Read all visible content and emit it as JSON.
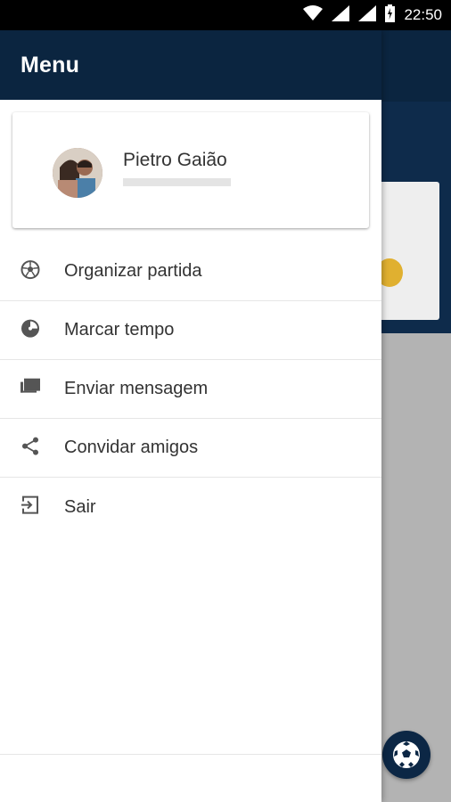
{
  "status_bar": {
    "time": "22:50"
  },
  "drawer": {
    "title": "Menu",
    "profile": {
      "name": "Pietro Gaião"
    },
    "items": [
      {
        "label": "Organizar partida",
        "icon": "soccer-ball-icon"
      },
      {
        "label": "Marcar tempo",
        "icon": "timer-icon"
      },
      {
        "label": "Enviar mensagem",
        "icon": "message-icon"
      },
      {
        "label": "Convidar amigos",
        "icon": "share-icon"
      },
      {
        "label": "Sair",
        "icon": "exit-icon"
      }
    ]
  },
  "colors": {
    "primary": "#0b2540",
    "background_dim": "#b3b3b3",
    "text": "#333333"
  }
}
